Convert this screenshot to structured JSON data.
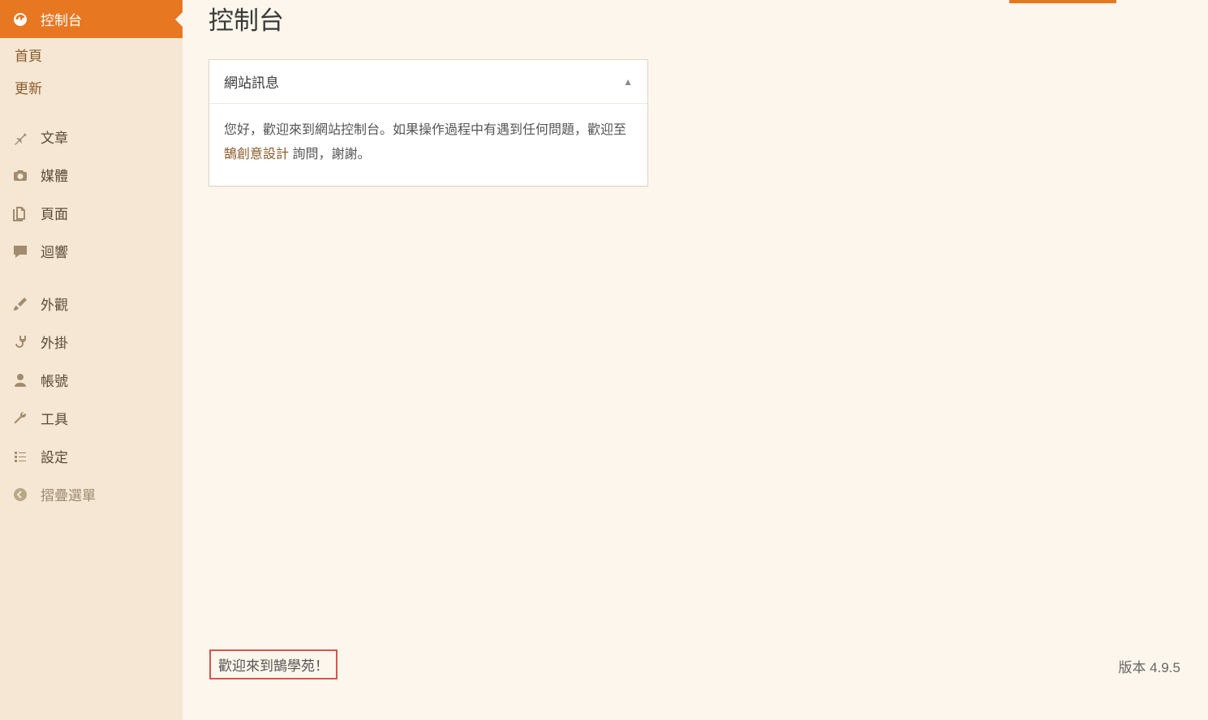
{
  "page_title": "控制台",
  "sidebar": {
    "items": [
      {
        "icon": "dashboard",
        "label": "控制台",
        "active": true
      },
      {
        "sub": true,
        "label": "首頁"
      },
      {
        "sub": true,
        "label": "更新"
      },
      {
        "sep": true
      },
      {
        "icon": "pin",
        "label": "文章"
      },
      {
        "icon": "camera",
        "label": "媒體"
      },
      {
        "icon": "pages",
        "label": "頁面"
      },
      {
        "icon": "comment",
        "label": "迴響"
      },
      {
        "sep": true
      },
      {
        "icon": "brush",
        "label": "外觀"
      },
      {
        "icon": "plug",
        "label": "外掛"
      },
      {
        "icon": "user",
        "label": "帳號"
      },
      {
        "icon": "wrench",
        "label": "工具"
      },
      {
        "icon": "sliders",
        "label": "設定"
      },
      {
        "icon": "collapse",
        "label": "摺疊選單",
        "collapse": true
      }
    ]
  },
  "postbox": {
    "title": "網站訊息",
    "body_prefix": "您好，歡迎來到網站控制台。如果操作過程中有遇到任何問題，歡迎至 ",
    "body_link": "鵠創意設計",
    "body_suffix": " 詢問，謝謝。"
  },
  "footer": {
    "welcome": "歡迎來到鵠學苑！",
    "version": "版本 4.9.5"
  }
}
